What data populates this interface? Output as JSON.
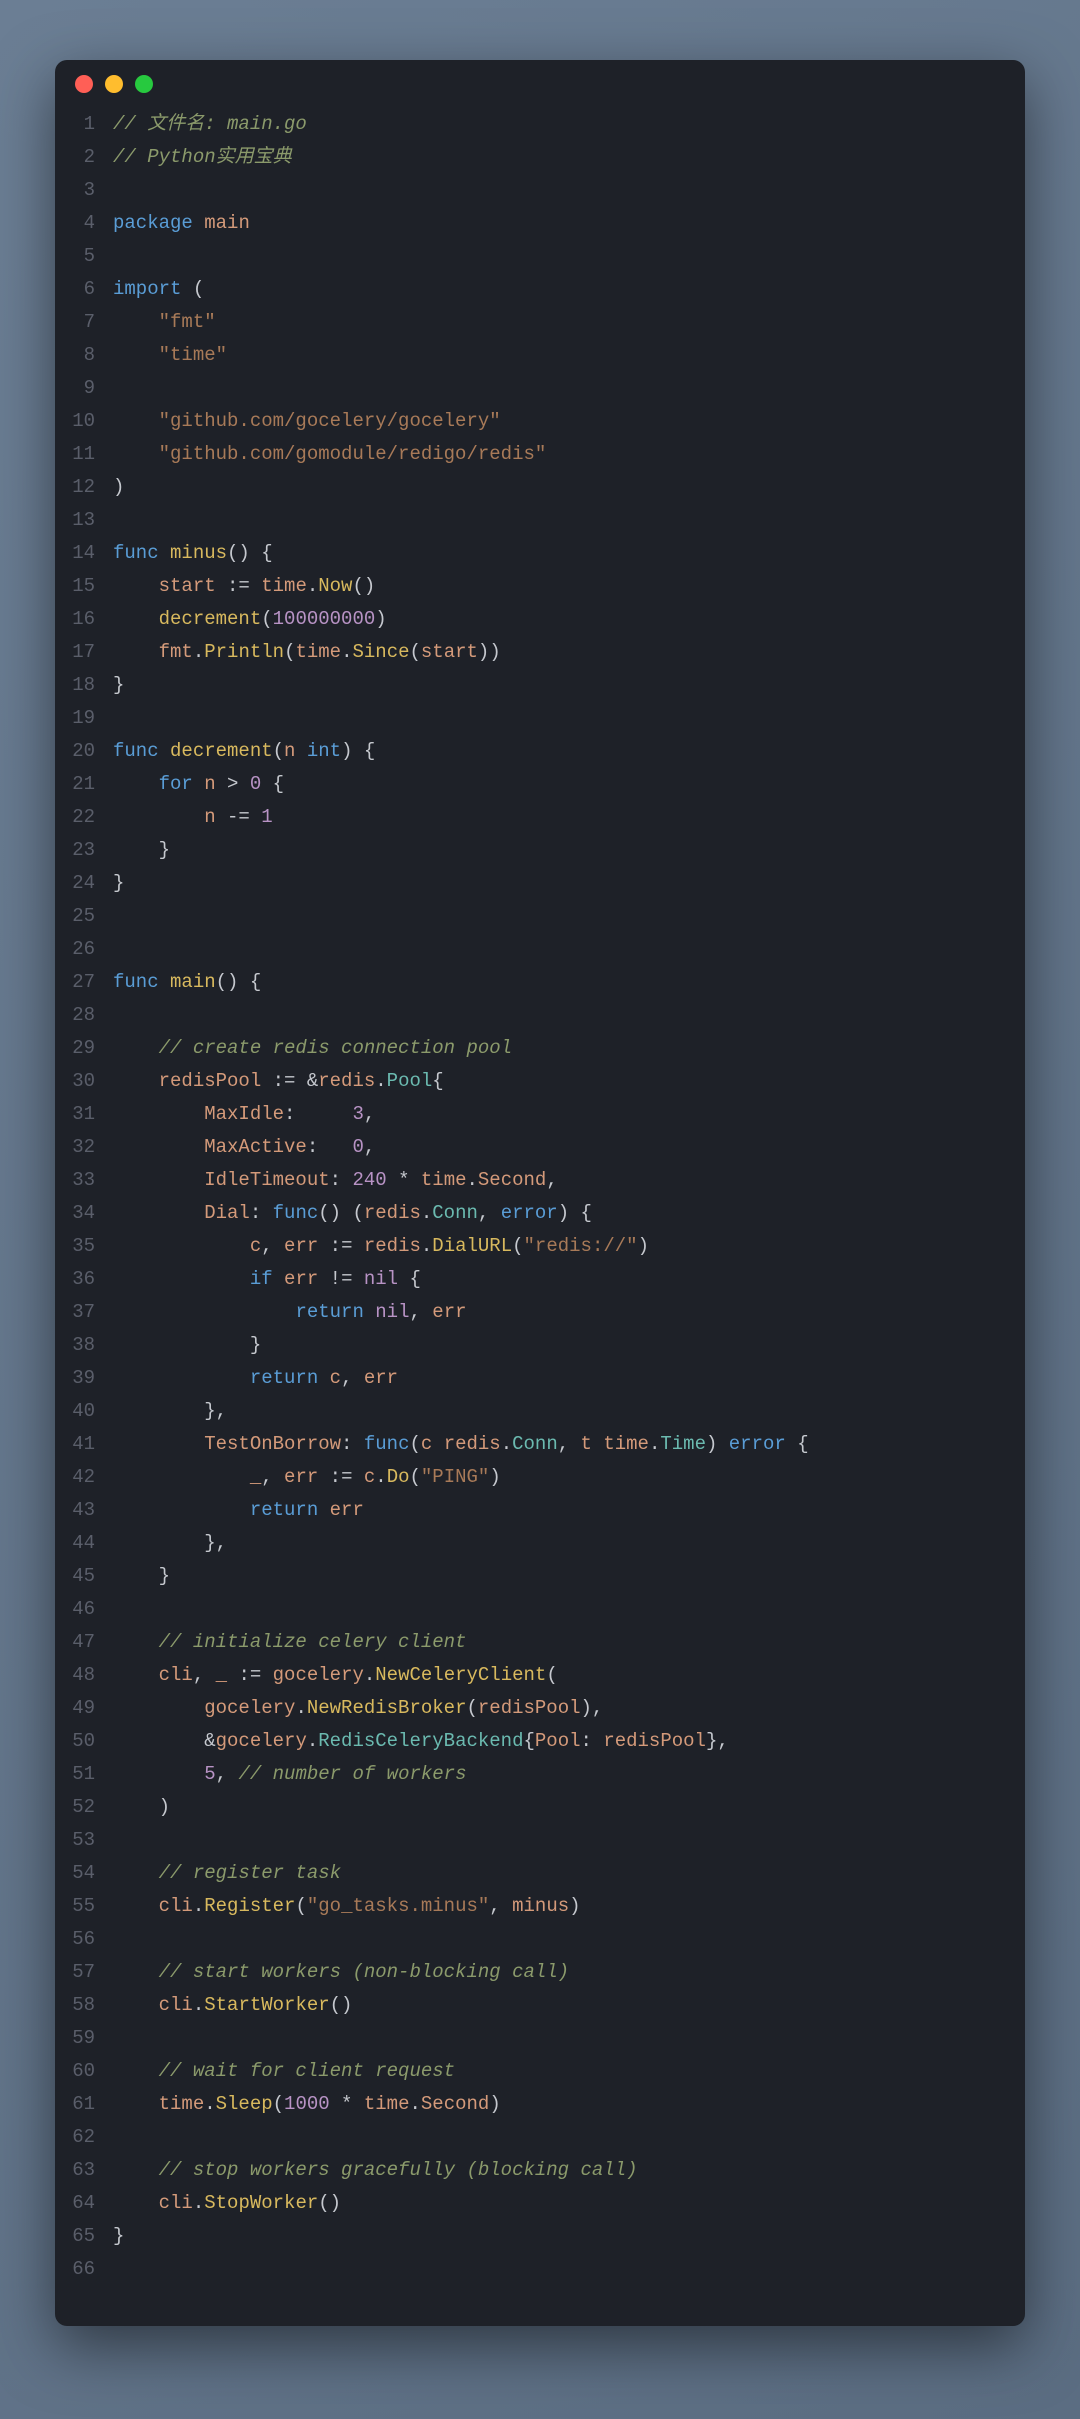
{
  "window": {
    "traffic_lights": [
      "red",
      "yellow",
      "green"
    ]
  },
  "code": {
    "language": "go",
    "lines": [
      {
        "n": 1,
        "tokens": [
          {
            "t": "// 文件名: main.go",
            "c": "comment"
          }
        ]
      },
      {
        "n": 2,
        "tokens": [
          {
            "t": "// Python实用宝典",
            "c": "comment"
          }
        ]
      },
      {
        "n": 3,
        "tokens": []
      },
      {
        "n": 4,
        "tokens": [
          {
            "t": "package",
            "c": "keyword"
          },
          {
            "t": " "
          },
          {
            "t": "main",
            "c": "ident"
          }
        ]
      },
      {
        "n": 5,
        "tokens": []
      },
      {
        "n": 6,
        "tokens": [
          {
            "t": "import",
            "c": "keyword"
          },
          {
            "t": " ("
          }
        ]
      },
      {
        "n": 7,
        "tokens": [
          {
            "t": "    "
          },
          {
            "t": "\"fmt\"",
            "c": "string"
          }
        ]
      },
      {
        "n": 8,
        "tokens": [
          {
            "t": "    "
          },
          {
            "t": "\"time\"",
            "c": "string"
          }
        ]
      },
      {
        "n": 9,
        "tokens": []
      },
      {
        "n": 10,
        "tokens": [
          {
            "t": "    "
          },
          {
            "t": "\"github.com/gocelery/gocelery\"",
            "c": "string"
          }
        ]
      },
      {
        "n": 11,
        "tokens": [
          {
            "t": "    "
          },
          {
            "t": "\"github.com/gomodule/redigo/redis\"",
            "c": "string"
          }
        ]
      },
      {
        "n": 12,
        "tokens": [
          {
            "t": ")"
          }
        ]
      },
      {
        "n": 13,
        "tokens": []
      },
      {
        "n": 14,
        "tokens": [
          {
            "t": "func",
            "c": "keyword"
          },
          {
            "t": " "
          },
          {
            "t": "minus",
            "c": "func"
          },
          {
            "t": "() {"
          }
        ]
      },
      {
        "n": 15,
        "tokens": [
          {
            "t": "    "
          },
          {
            "t": "start",
            "c": "ident"
          },
          {
            "t": " := "
          },
          {
            "t": "time",
            "c": "ident"
          },
          {
            "t": "."
          },
          {
            "t": "Now",
            "c": "func"
          },
          {
            "t": "()"
          }
        ]
      },
      {
        "n": 16,
        "tokens": [
          {
            "t": "    "
          },
          {
            "t": "decrement",
            "c": "func"
          },
          {
            "t": "("
          },
          {
            "t": "100000000",
            "c": "number"
          },
          {
            "t": ")"
          }
        ]
      },
      {
        "n": 17,
        "tokens": [
          {
            "t": "    "
          },
          {
            "t": "fmt",
            "c": "ident"
          },
          {
            "t": "."
          },
          {
            "t": "Println",
            "c": "func"
          },
          {
            "t": "("
          },
          {
            "t": "time",
            "c": "ident"
          },
          {
            "t": "."
          },
          {
            "t": "Since",
            "c": "func"
          },
          {
            "t": "("
          },
          {
            "t": "start",
            "c": "ident"
          },
          {
            "t": "))"
          }
        ]
      },
      {
        "n": 18,
        "tokens": [
          {
            "t": "}"
          }
        ]
      },
      {
        "n": 19,
        "tokens": []
      },
      {
        "n": 20,
        "tokens": [
          {
            "t": "func",
            "c": "keyword"
          },
          {
            "t": " "
          },
          {
            "t": "decrement",
            "c": "func"
          },
          {
            "t": "("
          },
          {
            "t": "n",
            "c": "ident"
          },
          {
            "t": " "
          },
          {
            "t": "int",
            "c": "type"
          },
          {
            "t": ") {"
          }
        ]
      },
      {
        "n": 21,
        "tokens": [
          {
            "t": "    "
          },
          {
            "t": "for",
            "c": "keyword"
          },
          {
            "t": " "
          },
          {
            "t": "n",
            "c": "ident"
          },
          {
            "t": " > "
          },
          {
            "t": "0",
            "c": "number"
          },
          {
            "t": " {"
          }
        ]
      },
      {
        "n": 22,
        "tokens": [
          {
            "t": "        "
          },
          {
            "t": "n",
            "c": "ident"
          },
          {
            "t": " -= "
          },
          {
            "t": "1",
            "c": "number"
          }
        ]
      },
      {
        "n": 23,
        "tokens": [
          {
            "t": "    }"
          }
        ]
      },
      {
        "n": 24,
        "tokens": [
          {
            "t": "}"
          }
        ]
      },
      {
        "n": 25,
        "tokens": []
      },
      {
        "n": 26,
        "tokens": []
      },
      {
        "n": 27,
        "tokens": [
          {
            "t": "func",
            "c": "keyword"
          },
          {
            "t": " "
          },
          {
            "t": "main",
            "c": "func"
          },
          {
            "t": "() {"
          }
        ]
      },
      {
        "n": 28,
        "tokens": []
      },
      {
        "n": 29,
        "tokens": [
          {
            "t": "    "
          },
          {
            "t": "// create redis connection pool",
            "c": "comment"
          }
        ]
      },
      {
        "n": 30,
        "tokens": [
          {
            "t": "    "
          },
          {
            "t": "redisPool",
            "c": "ident"
          },
          {
            "t": " := &"
          },
          {
            "t": "redis",
            "c": "ident"
          },
          {
            "t": "."
          },
          {
            "t": "Pool",
            "c": "builtin"
          },
          {
            "t": "{"
          }
        ]
      },
      {
        "n": 31,
        "tokens": [
          {
            "t": "        "
          },
          {
            "t": "MaxIdle",
            "c": "ident"
          },
          {
            "t": ":     "
          },
          {
            "t": "3",
            "c": "number"
          },
          {
            "t": ","
          }
        ]
      },
      {
        "n": 32,
        "tokens": [
          {
            "t": "        "
          },
          {
            "t": "MaxActive",
            "c": "ident"
          },
          {
            "t": ":   "
          },
          {
            "t": "0",
            "c": "number"
          },
          {
            "t": ","
          }
        ]
      },
      {
        "n": 33,
        "tokens": [
          {
            "t": "        "
          },
          {
            "t": "IdleTimeout",
            "c": "ident"
          },
          {
            "t": ": "
          },
          {
            "t": "240",
            "c": "number"
          },
          {
            "t": " * "
          },
          {
            "t": "time",
            "c": "ident"
          },
          {
            "t": "."
          },
          {
            "t": "Second",
            "c": "ident"
          },
          {
            "t": ","
          }
        ]
      },
      {
        "n": 34,
        "tokens": [
          {
            "t": "        "
          },
          {
            "t": "Dial",
            "c": "ident"
          },
          {
            "t": ": "
          },
          {
            "t": "func",
            "c": "keyword"
          },
          {
            "t": "() ("
          },
          {
            "t": "redis",
            "c": "ident"
          },
          {
            "t": "."
          },
          {
            "t": "Conn",
            "c": "builtin"
          },
          {
            "t": ", "
          },
          {
            "t": "error",
            "c": "type"
          },
          {
            "t": ") {"
          }
        ]
      },
      {
        "n": 35,
        "tokens": [
          {
            "t": "            "
          },
          {
            "t": "c",
            "c": "ident"
          },
          {
            "t": ", "
          },
          {
            "t": "err",
            "c": "ident"
          },
          {
            "t": " := "
          },
          {
            "t": "redis",
            "c": "ident"
          },
          {
            "t": "."
          },
          {
            "t": "DialURL",
            "c": "func"
          },
          {
            "t": "("
          },
          {
            "t": "\"redis://\"",
            "c": "string"
          },
          {
            "t": ")"
          }
        ]
      },
      {
        "n": 36,
        "tokens": [
          {
            "t": "            "
          },
          {
            "t": "if",
            "c": "keyword"
          },
          {
            "t": " "
          },
          {
            "t": "err",
            "c": "ident"
          },
          {
            "t": " != "
          },
          {
            "t": "nil",
            "c": "const"
          },
          {
            "t": " {"
          }
        ]
      },
      {
        "n": 37,
        "tokens": [
          {
            "t": "                "
          },
          {
            "t": "return",
            "c": "keyword"
          },
          {
            "t": " "
          },
          {
            "t": "nil",
            "c": "const"
          },
          {
            "t": ", "
          },
          {
            "t": "err",
            "c": "ident"
          }
        ]
      },
      {
        "n": 38,
        "tokens": [
          {
            "t": "            }"
          }
        ]
      },
      {
        "n": 39,
        "tokens": [
          {
            "t": "            "
          },
          {
            "t": "return",
            "c": "keyword"
          },
          {
            "t": " "
          },
          {
            "t": "c",
            "c": "ident"
          },
          {
            "t": ", "
          },
          {
            "t": "err",
            "c": "ident"
          }
        ]
      },
      {
        "n": 40,
        "tokens": [
          {
            "t": "        },"
          }
        ]
      },
      {
        "n": 41,
        "tokens": [
          {
            "t": "        "
          },
          {
            "t": "TestOnBorrow",
            "c": "ident"
          },
          {
            "t": ": "
          },
          {
            "t": "func",
            "c": "keyword"
          },
          {
            "t": "("
          },
          {
            "t": "c",
            "c": "ident"
          },
          {
            "t": " "
          },
          {
            "t": "redis",
            "c": "ident"
          },
          {
            "t": "."
          },
          {
            "t": "Conn",
            "c": "builtin"
          },
          {
            "t": ", "
          },
          {
            "t": "t",
            "c": "ident"
          },
          {
            "t": " "
          },
          {
            "t": "time",
            "c": "ident"
          },
          {
            "t": "."
          },
          {
            "t": "Time",
            "c": "builtin"
          },
          {
            "t": ") "
          },
          {
            "t": "error",
            "c": "type"
          },
          {
            "t": " {"
          }
        ]
      },
      {
        "n": 42,
        "tokens": [
          {
            "t": "            "
          },
          {
            "t": "_",
            "c": "ident"
          },
          {
            "t": ", "
          },
          {
            "t": "err",
            "c": "ident"
          },
          {
            "t": " := "
          },
          {
            "t": "c",
            "c": "ident"
          },
          {
            "t": "."
          },
          {
            "t": "Do",
            "c": "func"
          },
          {
            "t": "("
          },
          {
            "t": "\"PING\"",
            "c": "string"
          },
          {
            "t": ")"
          }
        ]
      },
      {
        "n": 43,
        "tokens": [
          {
            "t": "            "
          },
          {
            "t": "return",
            "c": "keyword"
          },
          {
            "t": " "
          },
          {
            "t": "err",
            "c": "ident"
          }
        ]
      },
      {
        "n": 44,
        "tokens": [
          {
            "t": "        },"
          }
        ]
      },
      {
        "n": 45,
        "tokens": [
          {
            "t": "    }"
          }
        ]
      },
      {
        "n": 46,
        "tokens": []
      },
      {
        "n": 47,
        "tokens": [
          {
            "t": "    "
          },
          {
            "t": "// initialize celery client",
            "c": "comment"
          }
        ]
      },
      {
        "n": 48,
        "tokens": [
          {
            "t": "    "
          },
          {
            "t": "cli",
            "c": "ident"
          },
          {
            "t": ", "
          },
          {
            "t": "_",
            "c": "ident"
          },
          {
            "t": " := "
          },
          {
            "t": "gocelery",
            "c": "ident"
          },
          {
            "t": "."
          },
          {
            "t": "NewCeleryClient",
            "c": "func"
          },
          {
            "t": "("
          }
        ]
      },
      {
        "n": 49,
        "tokens": [
          {
            "t": "        "
          },
          {
            "t": "gocelery",
            "c": "ident"
          },
          {
            "t": "."
          },
          {
            "t": "NewRedisBroker",
            "c": "func"
          },
          {
            "t": "("
          },
          {
            "t": "redisPool",
            "c": "ident"
          },
          {
            "t": "),"
          }
        ]
      },
      {
        "n": 50,
        "tokens": [
          {
            "t": "        &"
          },
          {
            "t": "gocelery",
            "c": "ident"
          },
          {
            "t": "."
          },
          {
            "t": "RedisCeleryBackend",
            "c": "builtin"
          },
          {
            "t": "{"
          },
          {
            "t": "Pool",
            "c": "ident"
          },
          {
            "t": ": "
          },
          {
            "t": "redisPool",
            "c": "ident"
          },
          {
            "t": "},"
          }
        ]
      },
      {
        "n": 51,
        "tokens": [
          {
            "t": "        "
          },
          {
            "t": "5",
            "c": "number"
          },
          {
            "t": ", "
          },
          {
            "t": "// number of workers",
            "c": "comment"
          }
        ]
      },
      {
        "n": 52,
        "tokens": [
          {
            "t": "    )"
          }
        ]
      },
      {
        "n": 53,
        "tokens": []
      },
      {
        "n": 54,
        "tokens": [
          {
            "t": "    "
          },
          {
            "t": "// register task",
            "c": "comment"
          }
        ]
      },
      {
        "n": 55,
        "tokens": [
          {
            "t": "    "
          },
          {
            "t": "cli",
            "c": "ident"
          },
          {
            "t": "."
          },
          {
            "t": "Register",
            "c": "func"
          },
          {
            "t": "("
          },
          {
            "t": "\"go_tasks.minus\"",
            "c": "string"
          },
          {
            "t": ", "
          },
          {
            "t": "minus",
            "c": "ident"
          },
          {
            "t": ")"
          }
        ]
      },
      {
        "n": 56,
        "tokens": []
      },
      {
        "n": 57,
        "tokens": [
          {
            "t": "    "
          },
          {
            "t": "// start workers (non-blocking call)",
            "c": "comment"
          }
        ]
      },
      {
        "n": 58,
        "tokens": [
          {
            "t": "    "
          },
          {
            "t": "cli",
            "c": "ident"
          },
          {
            "t": "."
          },
          {
            "t": "StartWorker",
            "c": "func"
          },
          {
            "t": "()"
          }
        ]
      },
      {
        "n": 59,
        "tokens": []
      },
      {
        "n": 60,
        "tokens": [
          {
            "t": "    "
          },
          {
            "t": "// wait for client request",
            "c": "comment"
          }
        ]
      },
      {
        "n": 61,
        "tokens": [
          {
            "t": "    "
          },
          {
            "t": "time",
            "c": "ident"
          },
          {
            "t": "."
          },
          {
            "t": "Sleep",
            "c": "func"
          },
          {
            "t": "("
          },
          {
            "t": "1000",
            "c": "number"
          },
          {
            "t": " * "
          },
          {
            "t": "time",
            "c": "ident"
          },
          {
            "t": "."
          },
          {
            "t": "Second",
            "c": "ident"
          },
          {
            "t": ")"
          }
        ]
      },
      {
        "n": 62,
        "tokens": []
      },
      {
        "n": 63,
        "tokens": [
          {
            "t": "    "
          },
          {
            "t": "// stop workers gracefully (blocking call)",
            "c": "comment"
          }
        ]
      },
      {
        "n": 64,
        "tokens": [
          {
            "t": "    "
          },
          {
            "t": "cli",
            "c": "ident"
          },
          {
            "t": "."
          },
          {
            "t": "StopWorker",
            "c": "func"
          },
          {
            "t": "()"
          }
        ]
      },
      {
        "n": 65,
        "tokens": [
          {
            "t": "}"
          }
        ]
      },
      {
        "n": 66,
        "tokens": []
      }
    ]
  }
}
